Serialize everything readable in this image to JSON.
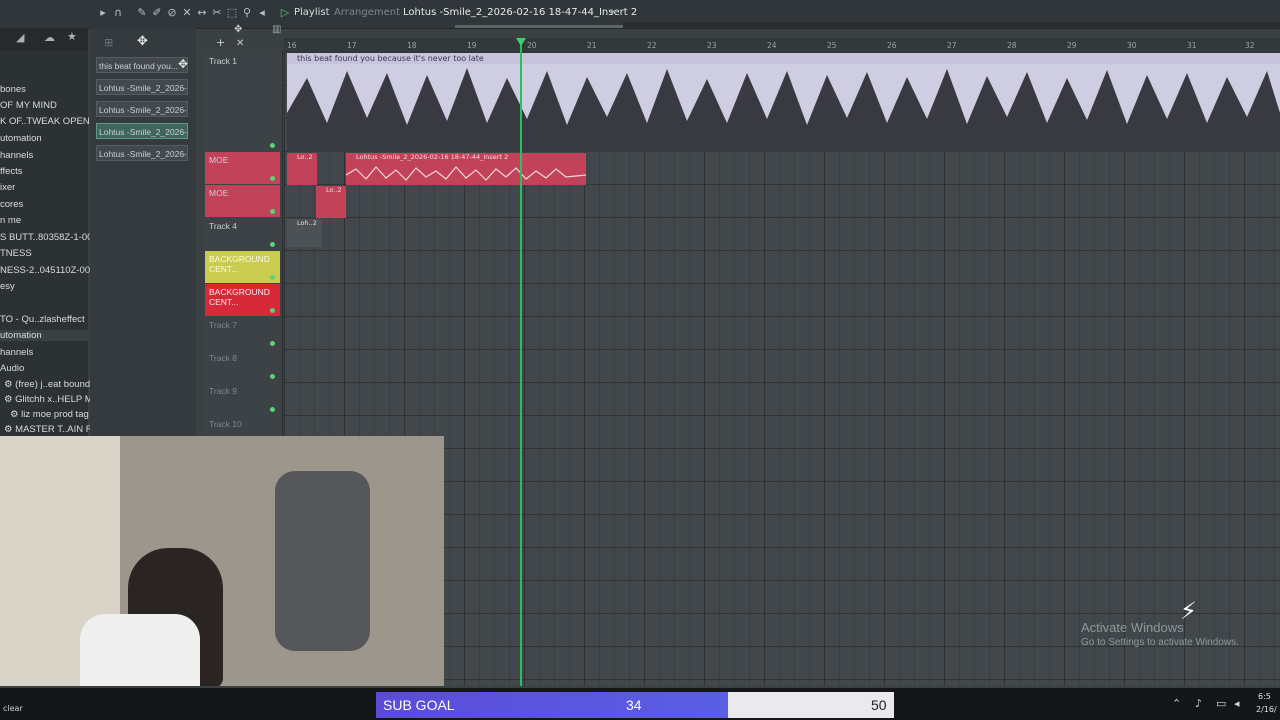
{
  "toolbar": {
    "window_title": "Playlist",
    "subtitle": "Arrangement",
    "selected_clip": "Lohtus -Smile_2_2026-02-16 18-47-44_Insert 2",
    "arrow": "▸"
  },
  "browser": {
    "items": [
      {
        "label": "bones"
      },
      {
        "label": "OF MY MIND"
      },
      {
        "label": "K OF..TWEAK OPEN"
      },
      {
        "label": "utomation"
      },
      {
        "label": "hannels"
      },
      {
        "label": "ffects"
      },
      {
        "label": "ixer"
      },
      {
        "label": "cores"
      },
      {
        "label": "n me"
      },
      {
        "label": "S BUTT..80358Z-1-001"
      },
      {
        "label": "TNESS"
      },
      {
        "label": "NESS-2..045110Z-001"
      },
      {
        "label": "esy"
      },
      {
        "label": "TO - Qu..zlasheffect"
      },
      {
        "label": "utomation"
      },
      {
        "label": "hannels"
      },
      {
        "label": "Audio"
      },
      {
        "label": "(free) j..eat bound"
      },
      {
        "label": "Glitchh x..HELP ME"
      },
      {
        "label": "liz moe prod tag"
      },
      {
        "label": "MASTER T..AIN REC"
      }
    ]
  },
  "picker": {
    "items": [
      {
        "label": "this beat found you..."
      },
      {
        "label": "Lohtus -Smile_2_2026-0..."
      },
      {
        "label": "Lohtus -Smile_2_2026-0..."
      },
      {
        "label": "Lohtus -Smile_2_2026-0..."
      },
      {
        "label": "Lohtus -Smile_2_2026-0..."
      }
    ]
  },
  "tracks": [
    {
      "name": "Track 1"
    },
    {
      "name": "MOE"
    },
    {
      "name": "MOE"
    },
    {
      "name": "Track 4"
    },
    {
      "name": "BACKGROUND CENT..."
    },
    {
      "name": "BACKGROUND CENT..."
    },
    {
      "name": "Track 7"
    },
    {
      "name": "Track 8"
    },
    {
      "name": "Track 9"
    },
    {
      "name": "Track 10"
    }
  ],
  "ruler": {
    "bars": [
      "16",
      "17",
      "18",
      "19",
      "20",
      "21",
      "22",
      "23",
      "24",
      "25",
      "26",
      "27",
      "28",
      "29",
      "30",
      "31",
      "32"
    ]
  },
  "clips": {
    "audio_main": "this beat found you because it's never too late",
    "moe_small": "Lo..2",
    "moe_long": "Lohtus -Smile_2_2026-02-16 18-47-44_Insert 2",
    "moe2_small": "Lo..2",
    "track4_small": "Loh..2"
  },
  "overlay": {
    "goal_label": "SUB GOAL",
    "goal_current": "34",
    "goal_max": "50",
    "goal_progress": 0.68,
    "clear_text": "clear",
    "activate_title": "Activate Windows",
    "activate_sub": "Go to Settings to activate Windows.",
    "clock_time": "6:5",
    "clock_date": "2/16/"
  },
  "colors": {
    "accent_green": "#27c05a",
    "clip_red": "#c2425a",
    "audio_purple": "#cfcde2",
    "goal_purple": "#5b4bd8"
  }
}
